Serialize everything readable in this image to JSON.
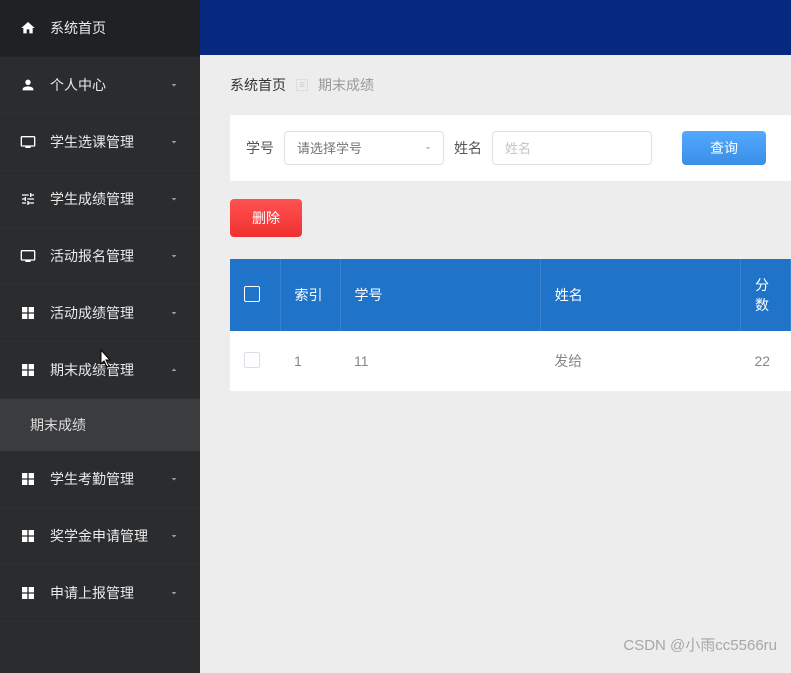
{
  "sidebar": {
    "items": [
      {
        "label": "系统首页",
        "icon": "home"
      },
      {
        "label": "个人中心",
        "icon": "person"
      },
      {
        "label": "学生选课管理",
        "icon": "monitor"
      },
      {
        "label": "学生成绩管理",
        "icon": "sliders"
      },
      {
        "label": "活动报名管理",
        "icon": "monitor"
      },
      {
        "label": "活动成绩管理",
        "icon": "grid"
      },
      {
        "label": "期末成绩管理",
        "icon": "grid",
        "expanded": true,
        "sub": [
          {
            "label": "期末成绩"
          }
        ]
      },
      {
        "label": "学生考勤管理",
        "icon": "grid"
      },
      {
        "label": "奖学金申请管理",
        "icon": "grid"
      },
      {
        "label": "申请上报管理",
        "icon": "grid"
      }
    ]
  },
  "breadcrumb": {
    "home": "系统首页",
    "current": "期末成绩"
  },
  "filter": {
    "xuehao_label": "学号",
    "xuehao_placeholder": "请选择学号",
    "xingming_label": "姓名",
    "xingming_placeholder": "姓名",
    "query_btn": "查询"
  },
  "actions": {
    "delete_btn": "删除"
  },
  "table": {
    "headers": {
      "index": "索引",
      "xuehao": "学号",
      "xingming": "姓名",
      "fenshu": "分数"
    },
    "rows": [
      {
        "index": "1",
        "xuehao": "11",
        "xingming": "发给",
        "fenshu": "22"
      }
    ]
  },
  "watermark": "CSDN @小雨cc5566ru"
}
